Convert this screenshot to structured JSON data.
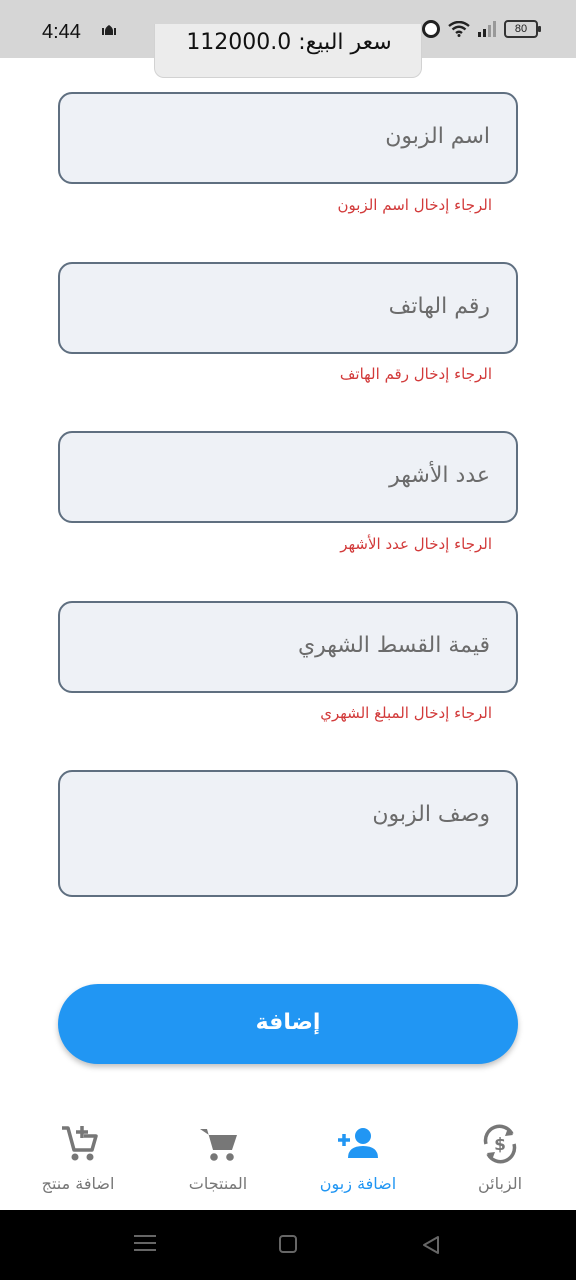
{
  "status_bar": {
    "time": "4:44",
    "battery": "80"
  },
  "toast": {
    "price_text": "سعر البيع: 112000.0"
  },
  "form": {
    "customer_name": {
      "placeholder": "اسم الزبون",
      "error": "الرجاء إدخال اسم الزبون"
    },
    "phone": {
      "placeholder": "رقم الهاتف",
      "error": "الرجاء إدخال رقم الهاتف"
    },
    "months": {
      "placeholder": "عدد الأشهر",
      "error": "الرجاء إدخال عدد الأشهر"
    },
    "monthly_installment": {
      "placeholder": "قيمة القسط الشهري",
      "error": "الرجاء إدخال المبلغ الشهري"
    },
    "description": {
      "placeholder": "وصف الزبون"
    },
    "submit_label": "إضافة"
  },
  "bottom_nav": {
    "items": [
      {
        "label": "اضافة منتج",
        "icon": "add-cart-icon",
        "active": false
      },
      {
        "label": "المنتجات",
        "icon": "cart-icon",
        "active": false
      },
      {
        "label": "اضافة زبون",
        "icon": "person-add-icon",
        "active": true
      },
      {
        "label": "الزبائن",
        "icon": "currency-exchange-icon",
        "active": false
      }
    ],
    "active_color": "#2196f3",
    "inactive_color": "#777777"
  },
  "colors": {
    "accent": "#2196f3",
    "error": "#d23a3a",
    "field_background": "#eef1f6",
    "field_border": "#5f6f80"
  }
}
